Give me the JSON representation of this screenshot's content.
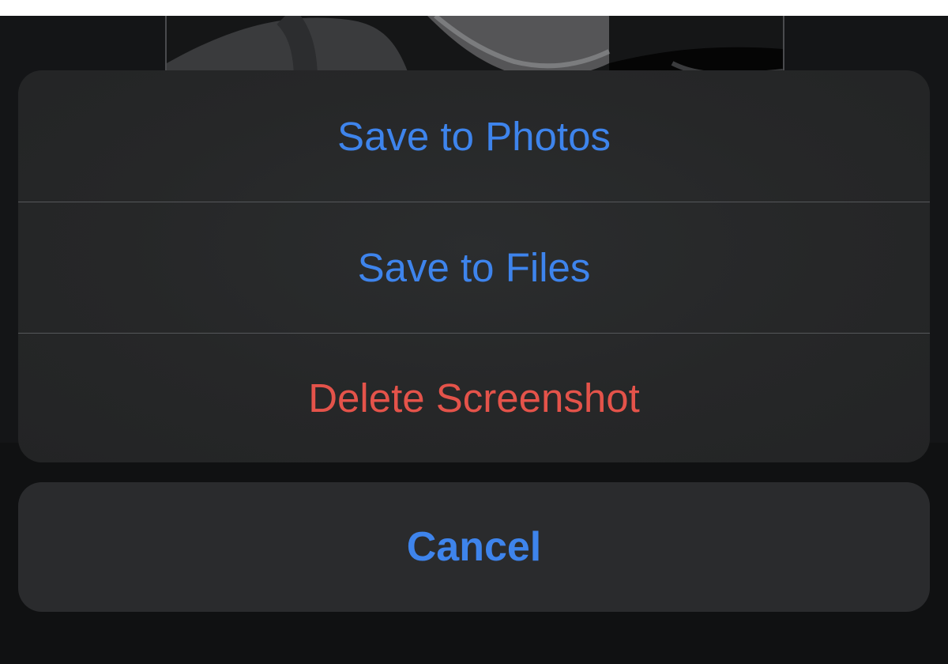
{
  "action_sheet": {
    "actions": [
      {
        "label": "Save to Photos",
        "style": "default"
      },
      {
        "label": "Save to Files",
        "style": "default"
      },
      {
        "label": "Delete Screenshot",
        "style": "destructive"
      }
    ],
    "cancel_label": "Cancel"
  },
  "colors": {
    "accent": "#3e84ec",
    "destructive": "#e4534a",
    "sheet_background": "#262728",
    "separator": "#55575a"
  }
}
